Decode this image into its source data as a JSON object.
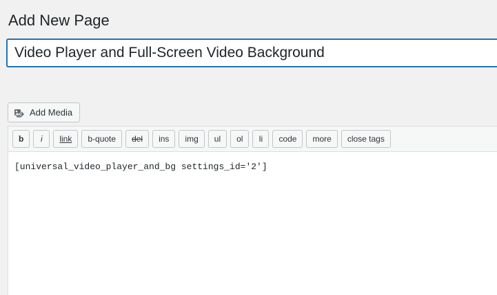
{
  "header": {
    "title": "Add New Page"
  },
  "post_title": {
    "value": "Video Player and Full-Screen Video Background"
  },
  "media": {
    "add_media_label": "Add Media",
    "icon": "add-media-icon"
  },
  "toolbar": {
    "buttons": [
      {
        "id": "b",
        "label": "b"
      },
      {
        "id": "i",
        "label": "i"
      },
      {
        "id": "link",
        "label": "link"
      },
      {
        "id": "block",
        "label": "b-quote"
      },
      {
        "id": "del",
        "label": "del"
      },
      {
        "id": "ins",
        "label": "ins"
      },
      {
        "id": "img",
        "label": "img"
      },
      {
        "id": "ul",
        "label": "ul"
      },
      {
        "id": "ol",
        "label": "ol"
      },
      {
        "id": "li",
        "label": "li"
      },
      {
        "id": "code",
        "label": "code"
      },
      {
        "id": "more",
        "label": "more"
      },
      {
        "id": "close",
        "label": "close tags"
      }
    ]
  },
  "editor": {
    "content": "[universal_video_player_and_bg settings_id='2']"
  },
  "colors": {
    "background": "#f1f1f1",
    "focus_border": "#2271b1",
    "button_border": "#c3c4c7",
    "text": "#1d2327"
  }
}
